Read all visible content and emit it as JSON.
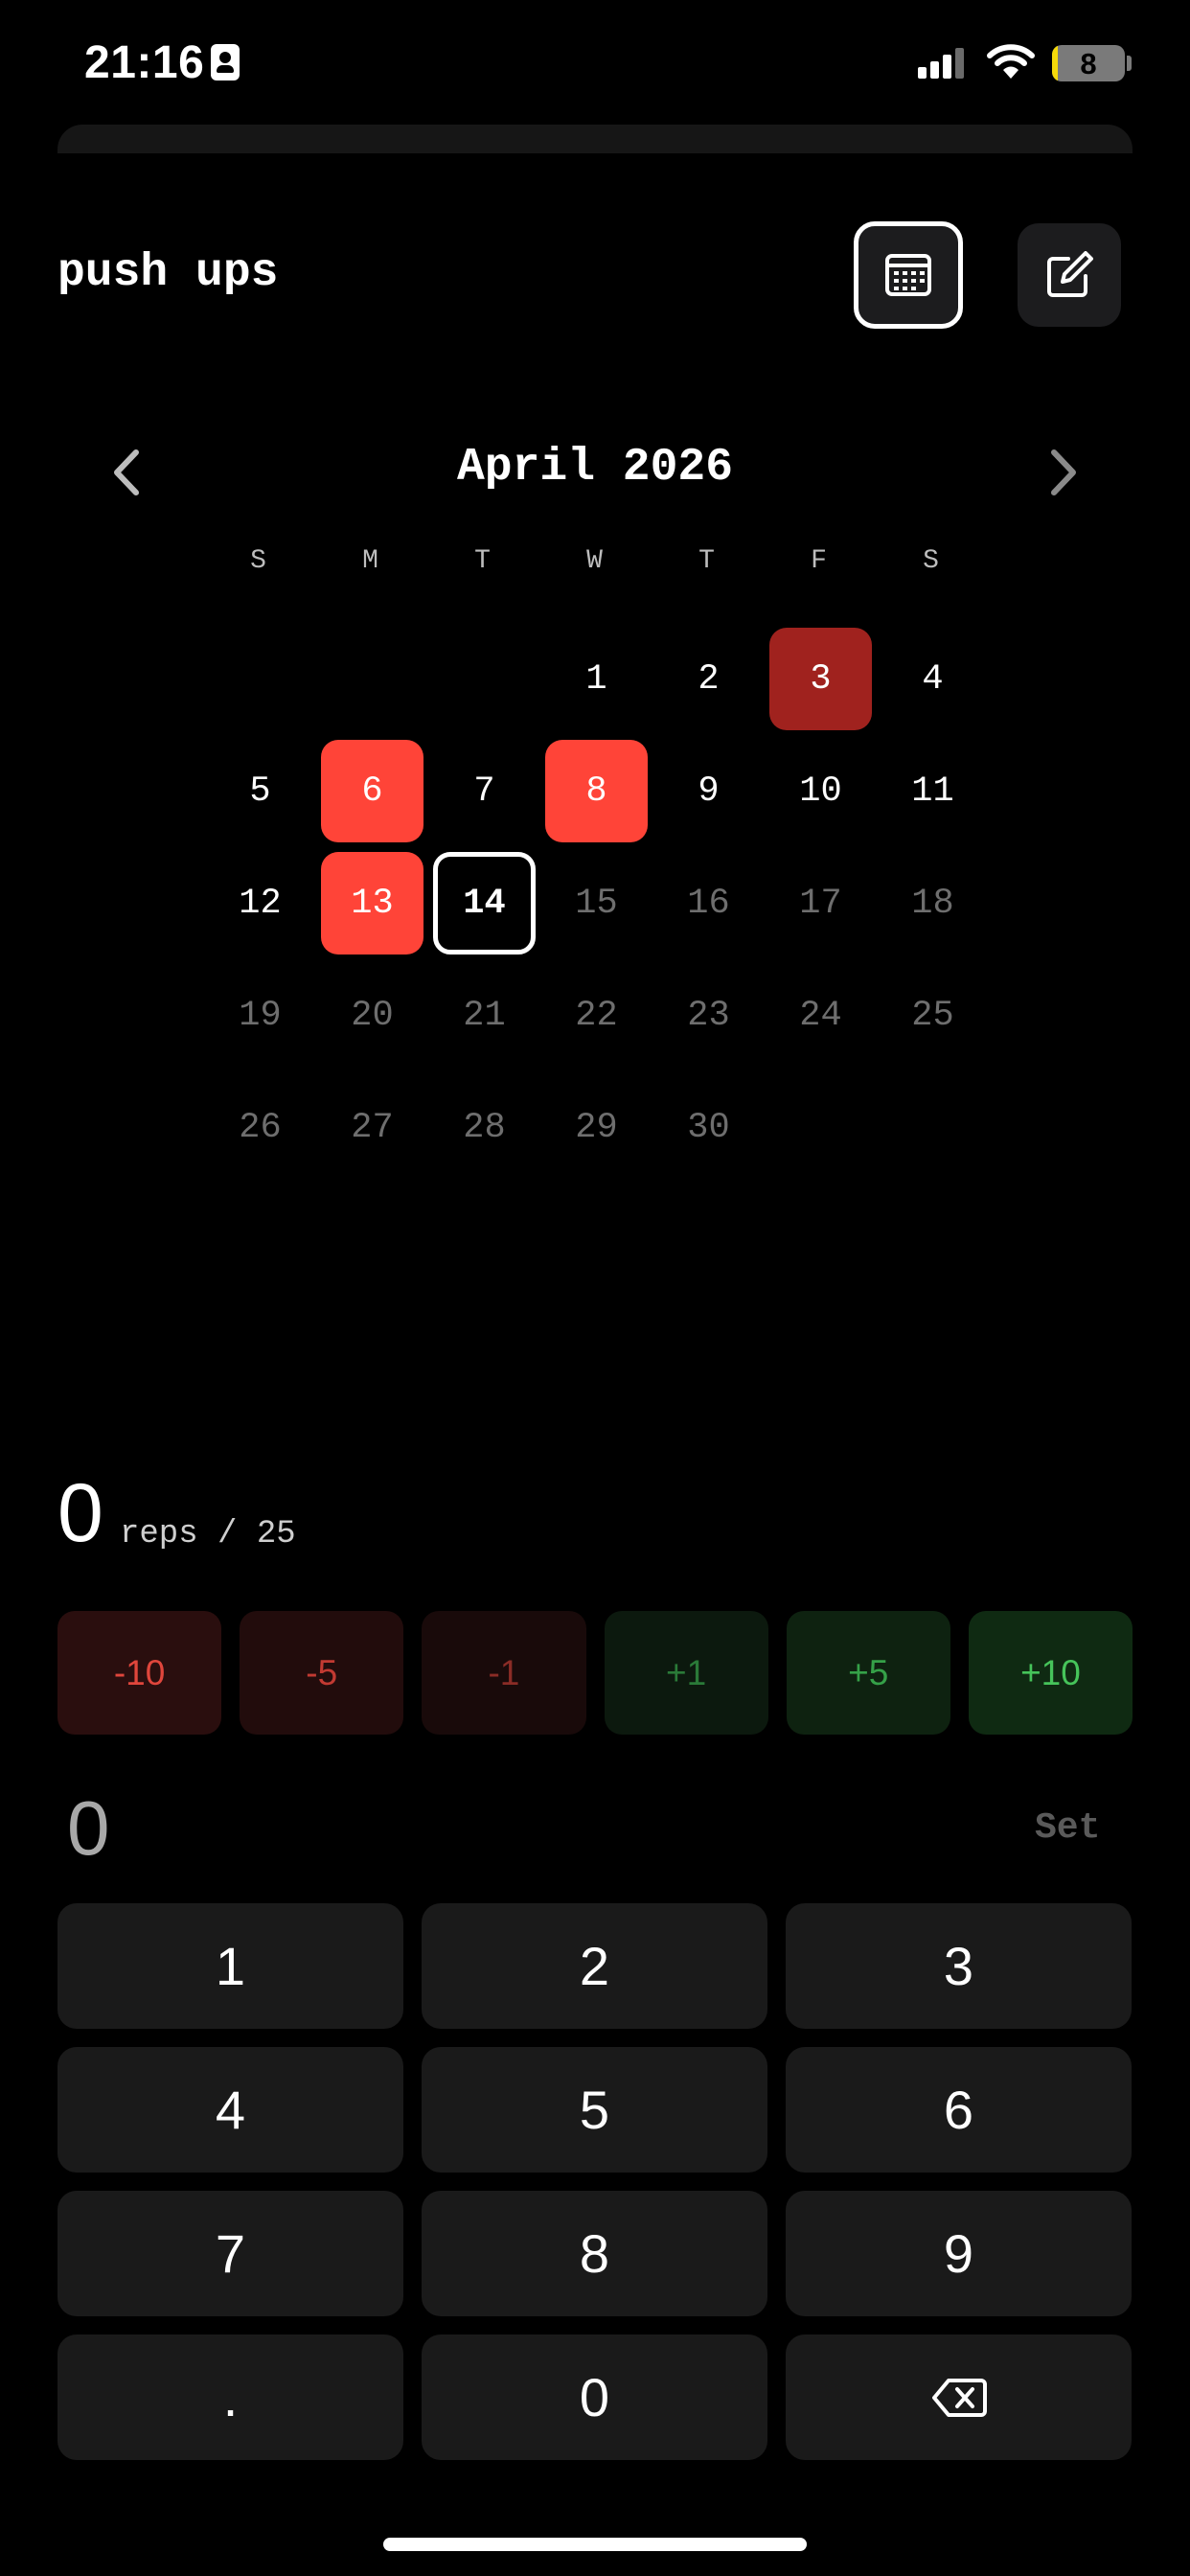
{
  "status_bar": {
    "time": "21:16",
    "battery": "8",
    "battery_level": 0.08
  },
  "header": {
    "title": "push ups",
    "calendar_icon": "calendar-icon",
    "edit_icon": "edit-icon"
  },
  "calendar": {
    "month": "April 2026",
    "weekdays": [
      "S",
      "M",
      "T",
      "W",
      "T",
      "F",
      "S"
    ],
    "weeks": [
      [
        {
          "day": ""
        },
        {
          "day": ""
        },
        {
          "day": ""
        },
        {
          "day": "1",
          "state": "normal"
        },
        {
          "day": "2",
          "state": "normal"
        },
        {
          "day": "3",
          "state": "done-dark"
        },
        {
          "day": "4",
          "state": "normal"
        }
      ],
      [
        {
          "day": "5",
          "state": "normal"
        },
        {
          "day": "6",
          "state": "done"
        },
        {
          "day": "7",
          "state": "normal"
        },
        {
          "day": "8",
          "state": "done"
        },
        {
          "day": "9",
          "state": "normal"
        },
        {
          "day": "10",
          "state": "normal"
        },
        {
          "day": "11",
          "state": "normal"
        }
      ],
      [
        {
          "day": "12",
          "state": "normal"
        },
        {
          "day": "13",
          "state": "done"
        },
        {
          "day": "14",
          "state": "today"
        },
        {
          "day": "15",
          "state": "future"
        },
        {
          "day": "16",
          "state": "future"
        },
        {
          "day": "17",
          "state": "future"
        },
        {
          "day": "18",
          "state": "future"
        }
      ],
      [
        {
          "day": "19",
          "state": "future"
        },
        {
          "day": "20",
          "state": "future"
        },
        {
          "day": "21",
          "state": "future"
        },
        {
          "day": "22",
          "state": "future"
        },
        {
          "day": "23",
          "state": "future"
        },
        {
          "day": "24",
          "state": "future"
        },
        {
          "day": "25",
          "state": "future"
        }
      ],
      [
        {
          "day": "26",
          "state": "future"
        },
        {
          "day": "27",
          "state": "future"
        },
        {
          "day": "28",
          "state": "future"
        },
        {
          "day": "29",
          "state": "future"
        },
        {
          "day": "30",
          "state": "future"
        },
        {
          "day": ""
        },
        {
          "day": ""
        }
      ]
    ],
    "colors": {
      "done": "#ff4438",
      "done_dark": "#a0221e",
      "future": "#6e6e6e"
    }
  },
  "counter": {
    "value": "0",
    "unit": "reps / 25"
  },
  "adjust": [
    "-10",
    "-5",
    "-1",
    "+1",
    "+5",
    "+10"
  ],
  "entry": {
    "value": "0",
    "set_label": "Set"
  },
  "keypad": [
    "1",
    "2",
    "3",
    "4",
    "5",
    "6",
    "7",
    "8",
    "9",
    ".",
    "0",
    "backspace"
  ]
}
